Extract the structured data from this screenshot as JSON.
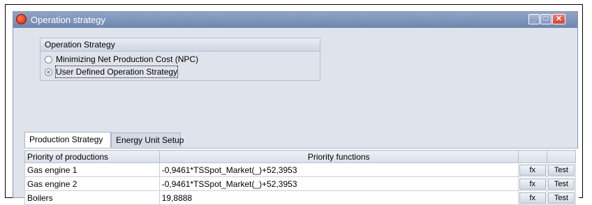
{
  "window": {
    "title": "Operation strategy",
    "controls": {
      "minimize": "_",
      "maximize": "□",
      "close": "✕"
    }
  },
  "strategy_group": {
    "header": "Operation Strategy",
    "options": [
      {
        "label": "Minimizing Net Production Cost (NPC)",
        "selected": false
      },
      {
        "label": "User Defined Operation Strategy",
        "selected": true
      }
    ]
  },
  "tabs": [
    {
      "label": "Production Strategy",
      "active": true
    },
    {
      "label": "Energy Unit Setup",
      "active": false
    }
  ],
  "table": {
    "headers": [
      "Priority of productions",
      "Priority functions",
      "",
      ""
    ],
    "rows": [
      {
        "name": "Gas engine 1",
        "function": "-0,9461*TSSpot_Market(_)+52,3953",
        "fx": "fx",
        "test": "Test"
      },
      {
        "name": "Gas engine 2",
        "function": "-0,9461*TSSpot_Market(_)+52,3953",
        "fx": "fx",
        "test": "Test"
      },
      {
        "name": "Boilers",
        "function": "19,8888",
        "fx": "fx",
        "test": "Test"
      }
    ]
  }
}
